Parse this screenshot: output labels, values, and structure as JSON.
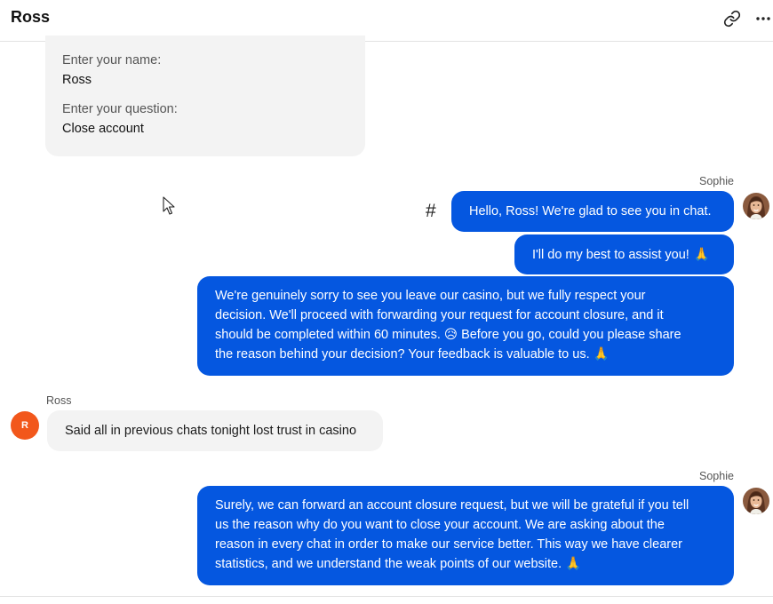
{
  "header": {
    "title": "Ross",
    "link_icon": "link-icon",
    "more_icon": "more-horizontal-icon"
  },
  "form": {
    "name_label": "Enter your name:",
    "name_value": "Ross",
    "question_label": "Enter your question:",
    "question_value": "Close account"
  },
  "messages": [
    {
      "sender": "Sophie",
      "text": "Hello, Ross! We're glad to see you in chat."
    },
    {
      "text": "I'll do my best to assist you!",
      "emoji": "🙏"
    },
    {
      "lines": [
        "We're genuinely sorry to see you leave our casino, but we fully respect your",
        "decision. We'll proceed with forwarding your request for account closure, and it",
        "should be completed within 60 minutes. 😥 Before you go, could you please share",
        "the reason behind your decision? Your feedback is valuable to us. 🙏"
      ]
    },
    {
      "sender": "Ross",
      "avatar_initial": "R",
      "text": "Said all in previous chats tonight lost trust in casino"
    },
    {
      "sender": "Sophie",
      "lines": [
        "Surely, we can forward an account closure request, but we will be grateful if you tell",
        "us the reason why do you want to close your account. We are asking about the",
        "reason in every chat in order to make our service better. This way we have clearer",
        "statistics, and we understand the weak points of our website. 🙏"
      ]
    }
  ],
  "hash_symbol": "#",
  "colors": {
    "agent_bubble": "#0557e0",
    "user_bubble": "#f3f3f3",
    "user_avatar": "#f2571b"
  }
}
